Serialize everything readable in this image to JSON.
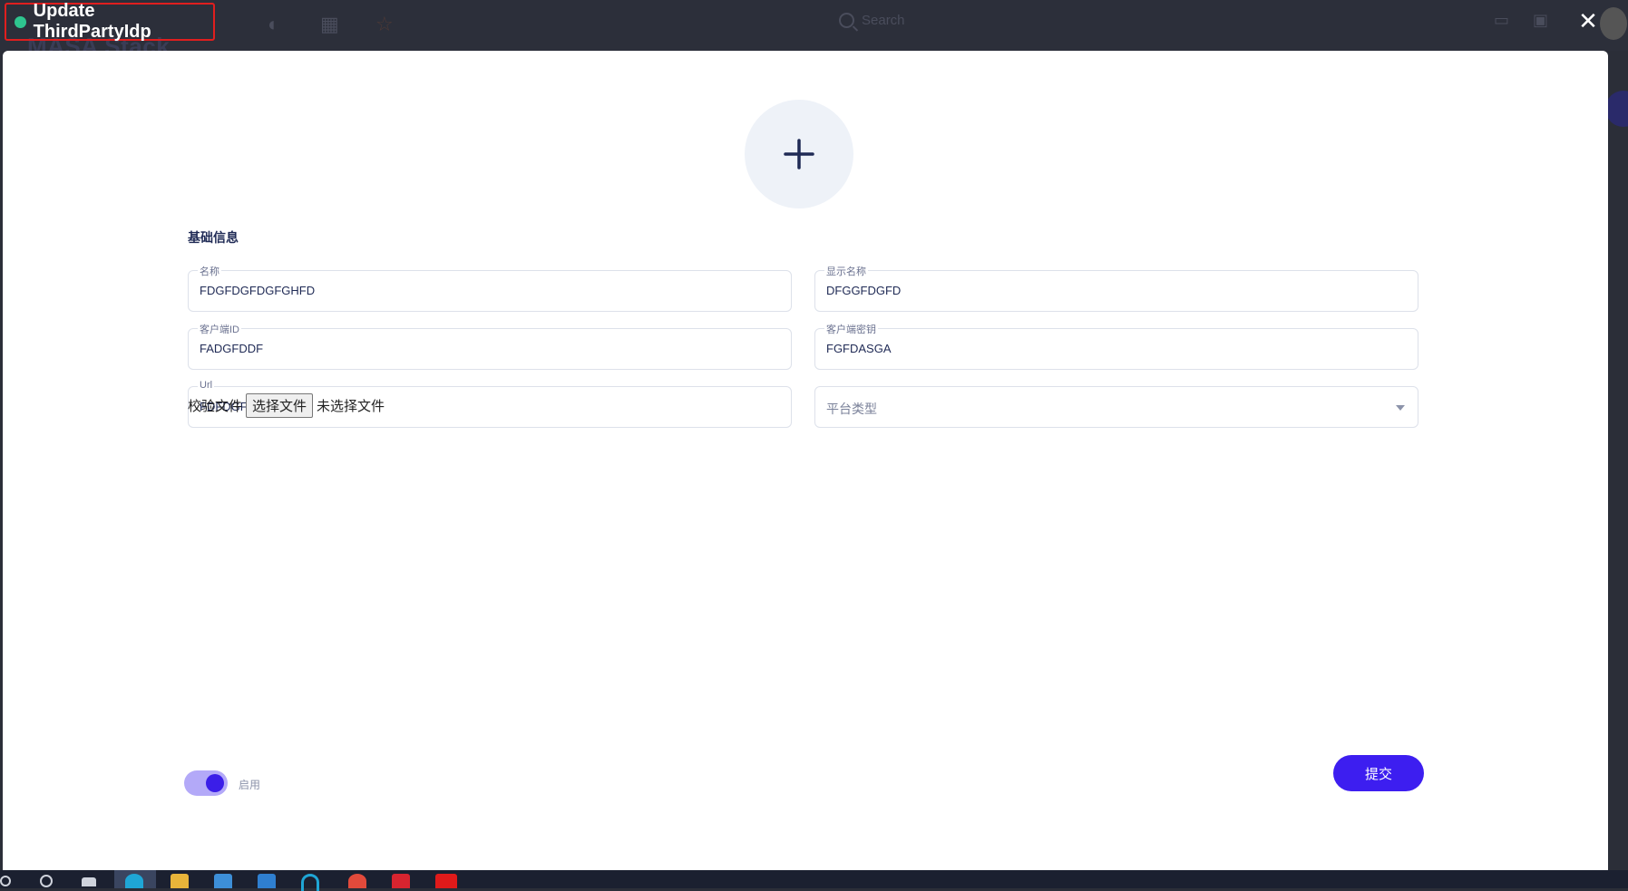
{
  "background": {
    "app_title": "MASA Stack",
    "search_placeholder": "Search"
  },
  "dialog": {
    "title": "Update ThirdPartyIdp",
    "status_color": "#2ec58f",
    "close_icon": "close-icon"
  },
  "form": {
    "section_title": "基础信息",
    "name": {
      "label": "名称",
      "value": "FDGFDGFDGFGHFD"
    },
    "display_name": {
      "label": "显示名称",
      "value": "DFGGFDGFD"
    },
    "client_id": {
      "label": "客户端ID",
      "value": "FADGFDDF"
    },
    "client_secret": {
      "label": "客户端密钥",
      "value": "FGFDASGA"
    },
    "url": {
      "label": "Url",
      "value": "FDFDGFDG"
    },
    "platform_type": {
      "placeholder": "平台类型"
    },
    "verify_file": {
      "label": "校验文件",
      "button": "选择文件",
      "status": "未选择文件"
    },
    "enabled": {
      "label": "启用",
      "value": true
    },
    "submit": "提交"
  },
  "colors": {
    "accent": "#3d1ef0",
    "title_text": "#1f2a55"
  }
}
